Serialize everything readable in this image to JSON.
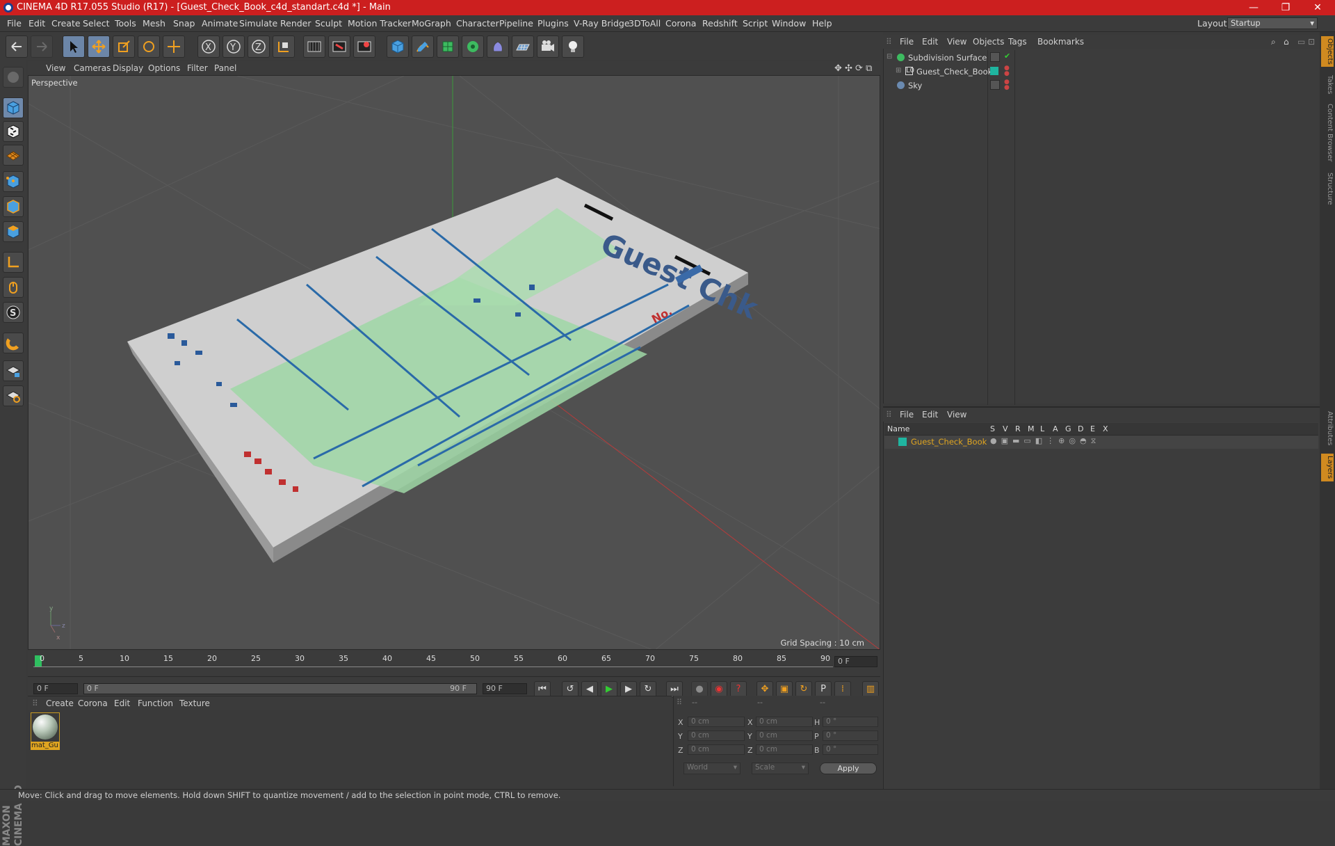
{
  "window": {
    "title": "CINEMA 4D R17.055 Studio (R17) - [Guest_Check_Book_c4d_standart.c4d *] - Main",
    "controls": [
      "—",
      "❐",
      "✕"
    ]
  },
  "menubar": {
    "items": [
      "File",
      "Edit",
      "Create",
      "Select",
      "Tools",
      "Mesh",
      "Snap",
      "Animate",
      "Simulate",
      "Render",
      "Sculpt",
      "Motion Tracker",
      "MoGraph",
      "Character",
      "Pipeline",
      "Plugins",
      "V-Ray Bridge",
      "3DToAll",
      "Corona",
      "Redshift",
      "Script",
      "Window",
      "Help"
    ],
    "layout_label": "Layout:",
    "layout_value": "Startup"
  },
  "viewport": {
    "menu": [
      "View",
      "Cameras",
      "Display",
      "Options",
      "Filter",
      "Panel"
    ],
    "label": "Perspective",
    "grid_spacing": "Grid Spacing : 10 cm",
    "model_texts": [
      "Guest Chk",
      "No."
    ]
  },
  "timeline": {
    "ticks": [
      "0",
      "5",
      "10",
      "15",
      "20",
      "25",
      "30",
      "35",
      "40",
      "45",
      "50",
      "55",
      "60",
      "65",
      "70",
      "75",
      "80",
      "85",
      "90"
    ],
    "current_frame_field": "0 F",
    "start_field": "0 F",
    "range_start": "0 F",
    "range_end": "90 F",
    "end_field": "90 F"
  },
  "material_manager": {
    "menu": [
      "Create",
      "Corona",
      "Edit",
      "Function",
      "Texture"
    ],
    "material_name": "mat_Gu"
  },
  "coordinates": {
    "header": [
      "--",
      "--",
      "--"
    ],
    "rows": [
      {
        "a": "X",
        "av": "0 cm",
        "b": "X",
        "bv": "0 cm",
        "c": "H",
        "cv": "0 °"
      },
      {
        "a": "Y",
        "av": "0 cm",
        "b": "Y",
        "bv": "0 cm",
        "c": "P",
        "cv": "0 °"
      },
      {
        "a": "Z",
        "av": "0 cm",
        "b": "Z",
        "bv": "0 cm",
        "c": "B",
        "cv": "0 °"
      }
    ],
    "mode1": "World",
    "mode2": "Scale",
    "apply": "Apply"
  },
  "object_manager": {
    "menu": [
      "File",
      "Edit",
      "View",
      "Objects",
      "Tags",
      "Bookmarks"
    ],
    "objects": [
      "Subdivision Surface",
      "Guest_Check_Book",
      "Sky"
    ]
  },
  "layer_manager": {
    "menu": [
      "File",
      "Edit",
      "View"
    ],
    "columns": [
      "Name",
      "S",
      "V",
      "R",
      "M",
      "L",
      "A",
      "G",
      "D",
      "E",
      "X"
    ],
    "layers": [
      "Guest_Check_Book"
    ]
  },
  "right_tabs": [
    "Objects",
    "Takes",
    "Content Browser",
    "Structure",
    "Attributes",
    "Layers"
  ],
  "status": "Move: Click and drag to move elements. Hold down SHIFT to quantize movement / add to the selection in point mode, CTRL to remove.",
  "branding": "MAXON CINEMA 4D",
  "colors": {
    "titlebar": "#cc1f1f",
    "selected_tool": "#6c86a8",
    "layer_color": "#1fb5a0",
    "current_layer_text": "#e0a520"
  }
}
